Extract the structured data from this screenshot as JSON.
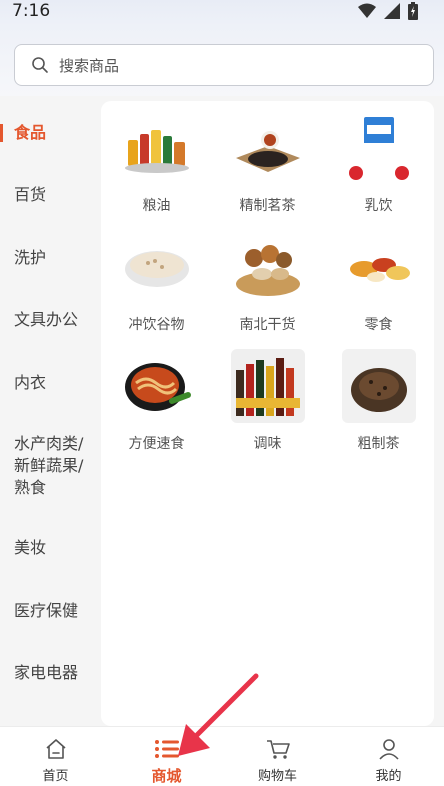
{
  "status_bar": {
    "time": "7:16",
    "icons": [
      "wifi-icon",
      "signal-icon",
      "battery-icon"
    ]
  },
  "search": {
    "placeholder": "搜索商品",
    "icon": "search-icon"
  },
  "sidebar": {
    "active_index": 0,
    "items": [
      {
        "label": "食品"
      },
      {
        "label": "百货"
      },
      {
        "label": "洗护"
      },
      {
        "label": "文具办公"
      },
      {
        "label": "内衣"
      },
      {
        "label": "水产肉类/新鲜蔬果/熟食"
      },
      {
        "label": "美妆"
      },
      {
        "label": "医疗保健"
      },
      {
        "label": "家电电器"
      }
    ]
  },
  "categories": [
    {
      "label": "粮油",
      "icon": "grain-oil-icon"
    },
    {
      "label": "精制茗茶",
      "icon": "tea-icon"
    },
    {
      "label": "乳饮",
      "icon": "milk-icon"
    },
    {
      "label": "冲饮谷物",
      "icon": "cereal-icon"
    },
    {
      "label": "南北干货",
      "icon": "nuts-icon"
    },
    {
      "label": "零食",
      "icon": "snacks-icon"
    },
    {
      "label": "方便速食",
      "icon": "noodles-icon"
    },
    {
      "label": "调味",
      "icon": "condiments-icon"
    },
    {
      "label": "粗制茶",
      "icon": "loose-tea-icon"
    }
  ],
  "tabbar": {
    "active_index": 1,
    "items": [
      {
        "label": "首页",
        "icon": "home-icon"
      },
      {
        "label": "商城",
        "icon": "list-icon"
      },
      {
        "label": "购物车",
        "icon": "cart-icon"
      },
      {
        "label": "我的",
        "icon": "user-icon"
      }
    ]
  },
  "colors": {
    "accent": "#e4572e",
    "background": "#f5f5f5",
    "card": "#ffffff"
  }
}
